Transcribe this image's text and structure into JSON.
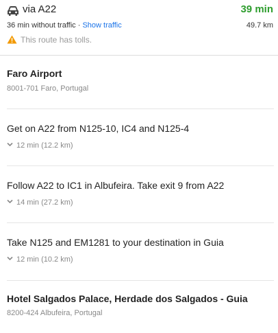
{
  "route": {
    "icon": "car-icon",
    "name": "via A22",
    "duration": "39 min",
    "duration_color": "#2e9d2e",
    "without_traffic": "36 min without traffic",
    "separator": " · ",
    "show_traffic_label": "Show traffic",
    "distance": "49.7 km",
    "warning_icon": "warning-icon",
    "warning_text": "This route has tolls."
  },
  "origin": {
    "name": "Faro Airport",
    "address": "8001-701 Faro, Portugal"
  },
  "steps": [
    {
      "instruction": "Get on A22 from N125-10, IC4 and N125-4",
      "detail": "12 min (12.2 km)"
    },
    {
      "instruction": "Follow A22 to IC1 in Albufeira. Take exit 9 from A22",
      "detail": "14 min (27.2 km)"
    },
    {
      "instruction": "Take N125 and EM1281 to your destination in Guia",
      "detail": "12 min (10.2 km)"
    }
  ],
  "destination": {
    "name": "Hotel Salgados Palace, Herdade dos Salgados - Guia",
    "address": "8200-424 Albufeira, Portugal"
  }
}
